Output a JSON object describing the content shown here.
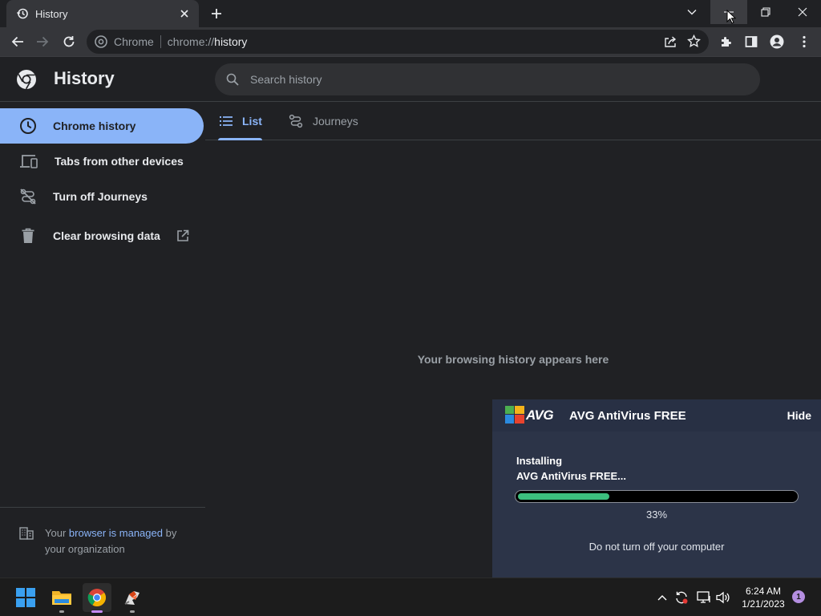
{
  "browser": {
    "tab": {
      "title": "History"
    },
    "omnibox": {
      "site_label": "Chrome",
      "url_scheme": "chrome://",
      "url_path": "history"
    }
  },
  "history": {
    "page_title": "History",
    "search": {
      "placeholder": "Search history"
    },
    "sidebar": {
      "items": [
        {
          "label": "Chrome history",
          "icon": "clock-icon",
          "active": true
        },
        {
          "label": "Tabs from other devices",
          "icon": "devices-icon",
          "active": false
        },
        {
          "label": "Turn off Journeys",
          "icon": "journeys-off-icon",
          "active": false
        },
        {
          "label": "Clear browsing data",
          "icon": "trash-icon",
          "active": false
        }
      ],
      "managed": {
        "prefix": "Your",
        "link": "browser is managed",
        "suffix": "by your organization"
      }
    },
    "tabs": [
      {
        "label": "List",
        "selected": true
      },
      {
        "label": "Journeys",
        "selected": false
      }
    ],
    "empty_message": "Your browsing history appears here"
  },
  "avg_popup": {
    "logo_text": "AVG",
    "title": "AVG AntiVirus FREE",
    "hide_label": "Hide",
    "status_line1": "Installing",
    "status_line2": "AVG AntiVirus FREE...",
    "progress_percent": 33,
    "progress_label": "33%",
    "warning": "Do not turn off your computer"
  },
  "taskbar": {
    "apps": [
      "windows-start-icon",
      "file-explorer-icon",
      "chrome-icon",
      "avg-installer-icon"
    ],
    "clock_time": "6:24 AM",
    "clock_date": "1/21/2023",
    "notification_count": "1"
  },
  "colors": {
    "accent": "#8ab4f8",
    "background": "#202124",
    "toolbar": "#35363a",
    "avg_panel": "#2c3448",
    "progress": "#3cbf7e"
  }
}
